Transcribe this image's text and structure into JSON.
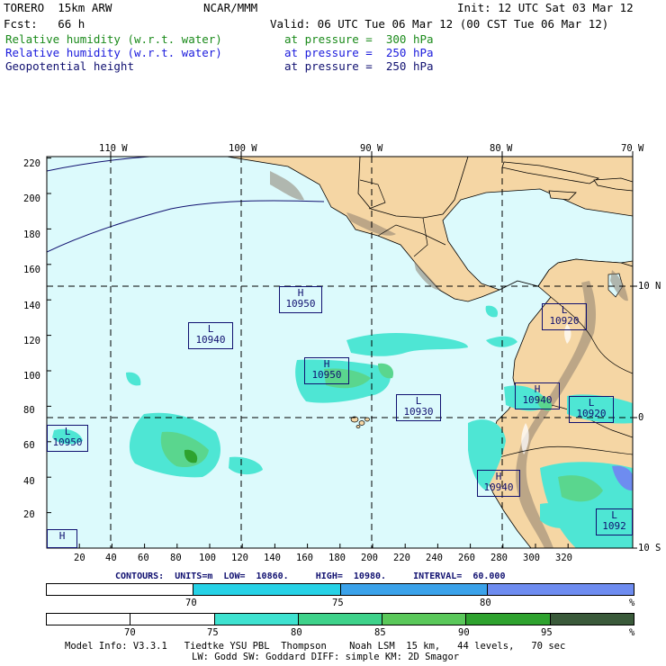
{
  "header": {
    "model": "TORERO  15km ARW",
    "center": "NCAR/MMM",
    "init": "Init: 12 UTC Sat 03 Mar 12",
    "fcst": "Fcst:   66 h",
    "valid": "Valid: 06 UTC Tue 06 Mar 12 (00 CST Tue 06 Mar 12)",
    "fields": [
      {
        "name": "Relative humidity (w.r.t. water)",
        "level": "at pressure =  300 hPa",
        "color": "#1a8a1a"
      },
      {
        "name": "Relative humidity (w.r.t. water)",
        "level": "at pressure =  250 hPa",
        "color": "#1a1adc"
      },
      {
        "name": "Geopotential height",
        "level": "at pressure =  250 hPa",
        "color": "#101070"
      }
    ]
  },
  "map": {
    "top_lon_labels": [
      "110 W",
      "100 W",
      "90 W",
      "80 W",
      "70 W"
    ],
    "right_lat_labels": [
      "10 N",
      "0",
      "10 S"
    ],
    "y_ticks": [
      "220",
      "200",
      "180",
      "160",
      "140",
      "120",
      "100",
      "80",
      "60",
      "40",
      "20"
    ],
    "x_ticks": [
      "20",
      "40",
      "60",
      "80",
      "100",
      "120",
      "140",
      "160",
      "180",
      "200",
      "220",
      "240",
      "260",
      "280",
      "300",
      "320"
    ],
    "pressure_centers": [
      {
        "type": "H",
        "value": "10950"
      },
      {
        "type": "L",
        "value": "10940"
      },
      {
        "type": "H",
        "value": "10950"
      },
      {
        "type": "L",
        "value": "10930"
      },
      {
        "type": "L",
        "value": "10950"
      },
      {
        "type": "L",
        "value": "10920"
      },
      {
        "type": "H",
        "value": "10940"
      },
      {
        "type": "L",
        "value": "10920"
      },
      {
        "type": "H",
        "value": "10940"
      },
      {
        "type": "L",
        "value": "1092"
      },
      {
        "type": "H",
        "value": ""
      }
    ]
  },
  "contours": {
    "caption": "CONTOURS:  UNITS=m  LOW=  10860.     HIGH=  10980.     INTERVAL=  60.000"
  },
  "legend1": {
    "labels": [
      "70",
      "75",
      "80",
      "%"
    ],
    "colors": [
      "#ffffff",
      "#26d2e6",
      "#3aa2ea",
      "#6e8cf0"
    ]
  },
  "legend2": {
    "labels": [
      "70",
      "75",
      "80",
      "85",
      "90",
      "95",
      "%"
    ],
    "colors": [
      "#ffffff",
      "#ffffff",
      "#3ee2d0",
      "#3ed28a",
      "#5ac85a",
      "#2ea22e",
      "#3a5a3a"
    ]
  },
  "footer": {
    "line1": "Model Info: V3.3.1   Tiedtke YSU PBL  Thompson    Noah LSM  15 km,   44 levels,   70 sec",
    "line2": "LW: Godd SW: Goddard DIFF: simple KM: 2D Smagor"
  }
}
